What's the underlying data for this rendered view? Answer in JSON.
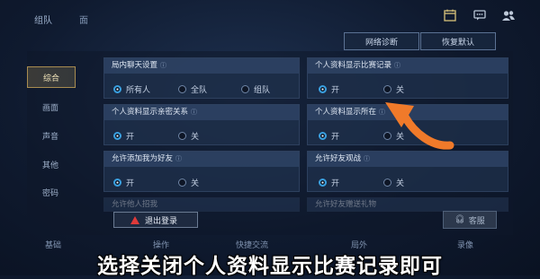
{
  "top_bar": {
    "tab_team": "组队",
    "tab_face": "面",
    "icons": [
      "calendar-icon",
      "chat-icon",
      "friends-icon"
    ]
  },
  "actions": {
    "diagnose": "网络诊断",
    "reset": "恢复默认"
  },
  "sidebar": {
    "items": [
      {
        "label": "综合",
        "active": true
      },
      {
        "label": "画面",
        "active": false
      },
      {
        "label": "声音",
        "active": false
      },
      {
        "label": "其他",
        "active": false
      },
      {
        "label": "密码",
        "active": false
      }
    ]
  },
  "cards": [
    {
      "title": "局内聊天设置",
      "options": [
        "所有人",
        "全队",
        "组队"
      ],
      "selected": 0
    },
    {
      "title": "个人资料显示比赛记录",
      "options": [
        "开",
        "关"
      ],
      "selected": 0
    },
    {
      "title": "个人资料显示亲密关系",
      "options": [
        "开",
        "关"
      ],
      "selected": 0
    },
    {
      "title": "个人资料显示所在",
      "options": [
        "开",
        "关"
      ],
      "selected": 0
    },
    {
      "title": "允许添加我为好友",
      "options": [
        "开",
        "关"
      ],
      "selected": 0
    },
    {
      "title": "允许好友观战",
      "options": [
        "开",
        "关"
      ],
      "selected": 0
    },
    {
      "title": "允许他人招我",
      "options": [],
      "selected": null
    },
    {
      "title": "允许好友赠送礼物",
      "options": [],
      "selected": null
    }
  ],
  "bottom": {
    "logout": "退出登录",
    "service": "客服",
    "tabs": [
      "基础",
      "操作",
      "快捷交流",
      "局外",
      "录像"
    ]
  },
  "caption": "选择关闭个人资料显示比赛记录即可",
  "colors": {
    "accent_gold": "#a88c50",
    "radio_blue": "#3aa0e0",
    "arrow_orange": "#f07a2a",
    "warn_red": "#e03a3a"
  }
}
